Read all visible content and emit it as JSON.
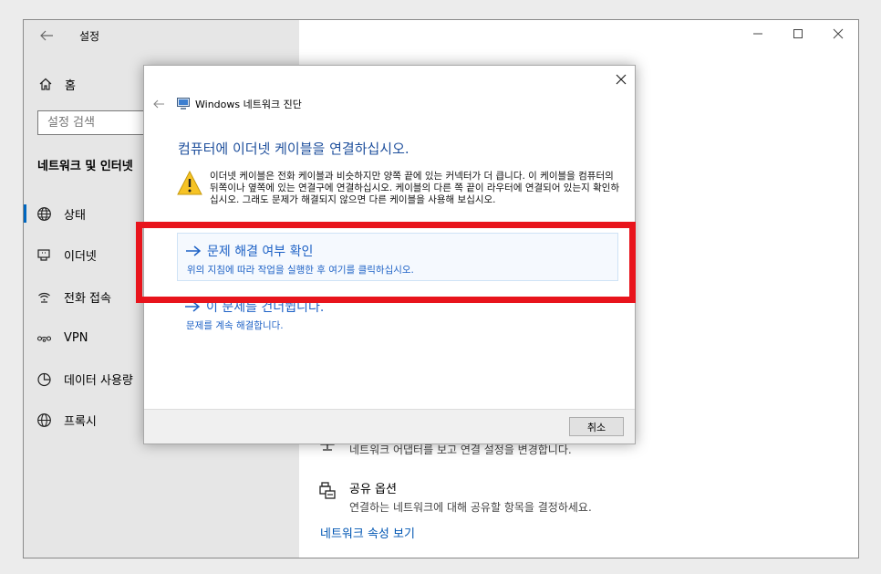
{
  "settings_window": {
    "title": "설정",
    "home_label": "홈",
    "search_placeholder": "설정 검색",
    "section_title": "네트워크 및 인터넷",
    "nav_items": [
      {
        "label": "상태",
        "icon": "globe-icon"
      },
      {
        "label": "이더넷",
        "icon": "ethernet-icon"
      },
      {
        "label": "전화 접속",
        "icon": "dialup-icon"
      },
      {
        "label": "VPN",
        "icon": "vpn-icon"
      },
      {
        "label": "데이터 사용량",
        "icon": "data-usage-icon"
      },
      {
        "label": "프록시",
        "icon": "proxy-globe-icon"
      }
    ],
    "selected_nav": "상태",
    "content": {
      "adapter_desc": "네트워크 어댑터를 보고 연결 설정을 변경합니다.",
      "sharing_title": "공유 옵션",
      "sharing_desc": "연결하는 네트워크에 대해 공유할 항목을 결정하세요.",
      "properties_link": "네트워크 속성 보기"
    }
  },
  "dialog": {
    "app_title": "Windows 네트워크 진단",
    "heading": "컴퓨터에 이더넷 케이블을 연결하십시오.",
    "warning_text": "이더넷 케이블은 전화 케이블과 비슷하지만 양쪽 끝에 있는 커넥터가 더 큽니다. 이 케이블을 컴퓨터의 뒤쪽이나 옆쪽에 있는 연결구에 연결하십시오. 케이블의 다른 쪽 끝이 라우터에 연결되어 있는지 확인하십시오. 그래도 문제가 해결되지 않으면 다른 케이블을 사용해 보십시오.",
    "options": [
      {
        "title": "문제 해결 여부 확인",
        "desc": "위의 지침에 따라 작업을 실행한 후 여기를 클릭하십시오."
      },
      {
        "title": "이 문제를 건너뜁니다.",
        "desc": "문제를 계속 해결합니다."
      }
    ],
    "cancel_label": "취소"
  },
  "colors": {
    "accent": "#0067c0",
    "link": "#1e62c6",
    "heading": "#1e4f9c",
    "highlight": "#e8141c"
  }
}
